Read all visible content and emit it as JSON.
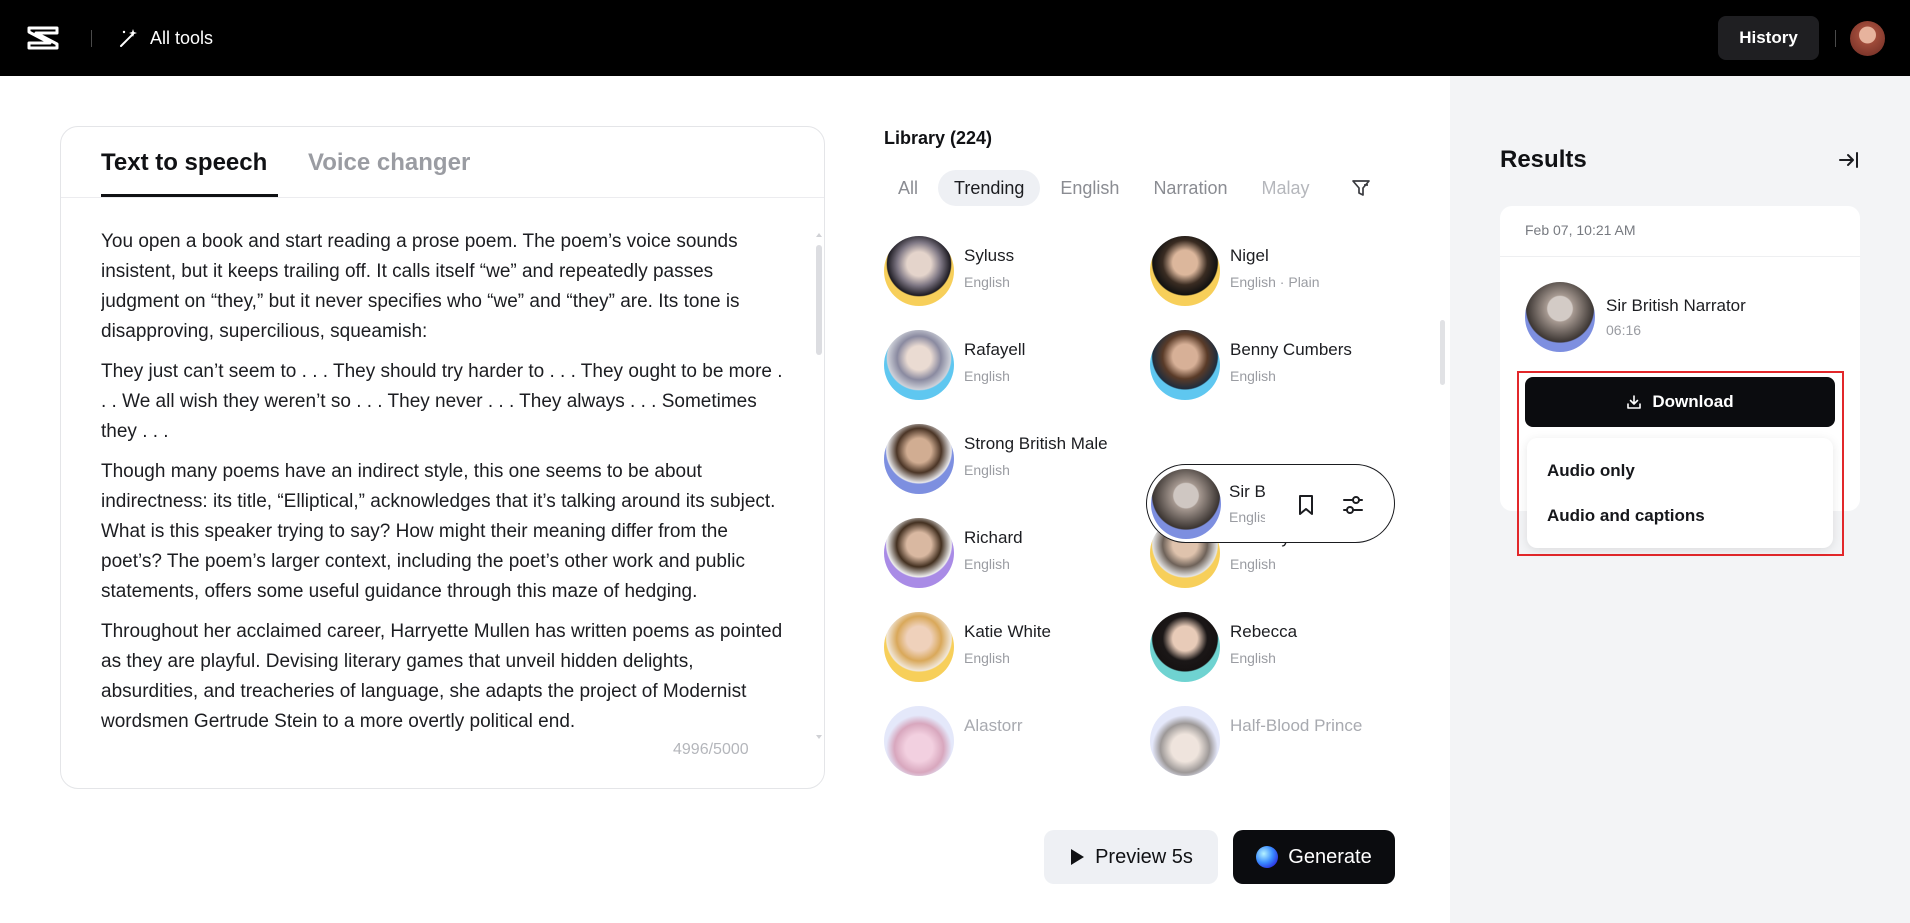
{
  "header": {
    "all_tools_label": "All tools",
    "history_label": "History"
  },
  "editor": {
    "tabs": [
      {
        "label": "Text to speech",
        "active": true
      },
      {
        "label": "Voice changer",
        "active": false
      }
    ],
    "paragraphs": [
      "You open a book and start reading a prose poem. The poem’s voice sounds insistent, but it keeps trailing off. It calls itself “we” and repeatedly passes judgment on “they,” but it never specifies who “we” and “they” are. Its tone is disapproving, supercilious, squeamish:",
      "They just can’t seem to . . . They should try harder to . . . They ought to be more . . . We all wish they weren’t so . . . They never . . . They always . . . Sometimes they . . .",
      "Though many poems have an indirect style, this one seems to be about indirectness: its title, “Elliptical,” acknowledges that it’s talking around its subject. What is this speaker trying to say? How might their meaning differ from the poet’s? The poem’s larger context, including the poet’s other work and public statements, offers some useful guidance through this maze of hedging.",
      "Throughout her acclaimed career, Harryette Mullen has written poems as pointed as they are playful. Devising literary games that unveil hidden delights, absurdities, and treacheries of language, she adapts the project of Modernist wordsmen Gertrude Stein to a more overtly political end."
    ],
    "char_count": "4996/5000"
  },
  "library": {
    "title": "Library (224)",
    "filters": [
      "All",
      "Trending",
      "English",
      "Narration",
      "Malay"
    ],
    "active_filter": "Trending",
    "voices": [
      {
        "name": "",
        "lang": "",
        "col": 0,
        "row": -1
      },
      {
        "name": "",
        "lang": "English",
        "col": 1,
        "row": -1
      },
      {
        "name": "Syluss",
        "lang": "English",
        "col": 0,
        "row": 0
      },
      {
        "name": "Nigel",
        "lang": "English · Plain",
        "col": 1,
        "row": 0
      },
      {
        "name": "Rafayell",
        "lang": "English",
        "col": 0,
        "row": 1
      },
      {
        "name": "Benny Cumbers",
        "lang": "English",
        "col": 1,
        "row": 1
      },
      {
        "name": "Strong British Male",
        "lang": "English",
        "col": 0,
        "row": 2
      },
      {
        "name": "Richard",
        "lang": "English",
        "col": 0,
        "row": 3
      },
      {
        "name": "Timothy",
        "lang": "English",
        "col": 1,
        "row": 3
      },
      {
        "name": "Katie White",
        "lang": "English",
        "col": 0,
        "row": 4
      },
      {
        "name": "Rebecca",
        "lang": "English",
        "col": 1,
        "row": 4
      },
      {
        "name": "Alastorr",
        "lang": "",
        "col": 0,
        "row": 5
      },
      {
        "name": "Half-Blood Prince",
        "lang": "",
        "col": 1,
        "row": 5
      }
    ],
    "selected_voice": {
      "name": "Sir Br",
      "lang": "English"
    }
  },
  "actions": {
    "preview_label": "Preview 5s",
    "generate_label": "Generate"
  },
  "results": {
    "title": "Results",
    "date": "Feb 07, 10:21 AM",
    "voice_name": "Sir British Narrator",
    "duration": "06:16",
    "download_label": "Download",
    "download_options": [
      "Audio only",
      "Audio and captions"
    ]
  },
  "colors": {
    "topbar": "#000000",
    "accent_dark": "#0b0c0f",
    "highlight": "#e2272a",
    "panel_bg": "#f3f4f6"
  }
}
